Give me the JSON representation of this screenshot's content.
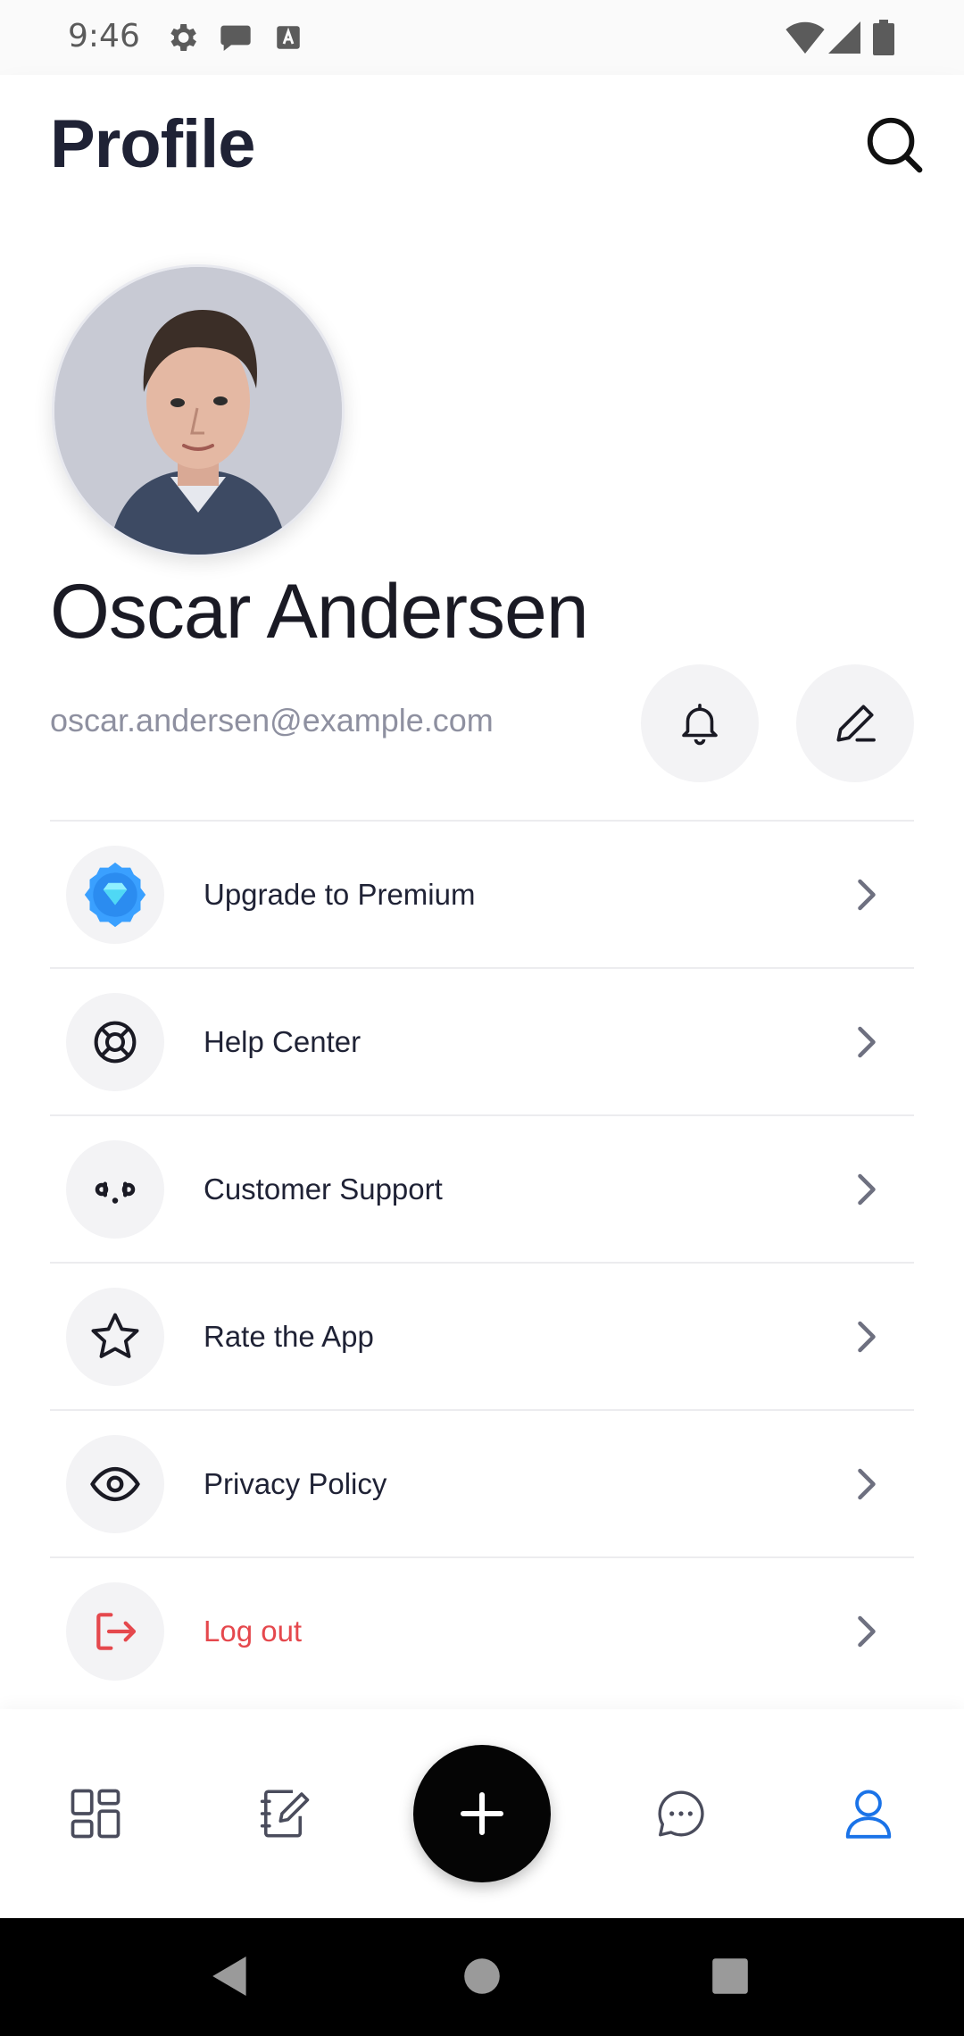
{
  "status_bar": {
    "time": "9:46"
  },
  "header": {
    "title": "Profile"
  },
  "profile": {
    "name": "Oscar Andersen",
    "email": "oscar.andersen@example.com"
  },
  "menu": {
    "items": [
      {
        "label": "Upgrade to Premium",
        "icon": "premium-gem-icon"
      },
      {
        "label": "Help Center",
        "icon": "lifebuoy-icon"
      },
      {
        "label": "Customer Support",
        "icon": "support-face-icon"
      },
      {
        "label": "Rate the App",
        "icon": "star-icon"
      },
      {
        "label": "Privacy Policy",
        "icon": "eye-icon"
      },
      {
        "label": "Log out",
        "icon": "logout-icon"
      }
    ]
  },
  "bottom_nav": {
    "items": [
      "dashboard-icon",
      "notes-icon",
      "add-icon",
      "chat-icon",
      "user-icon"
    ],
    "active": "user-icon"
  },
  "colors": {
    "accent": "#1a73e8",
    "danger": "#e5484d",
    "text": "#1f2235",
    "muted": "#8e90a0",
    "premium": "#3aa0ff"
  }
}
